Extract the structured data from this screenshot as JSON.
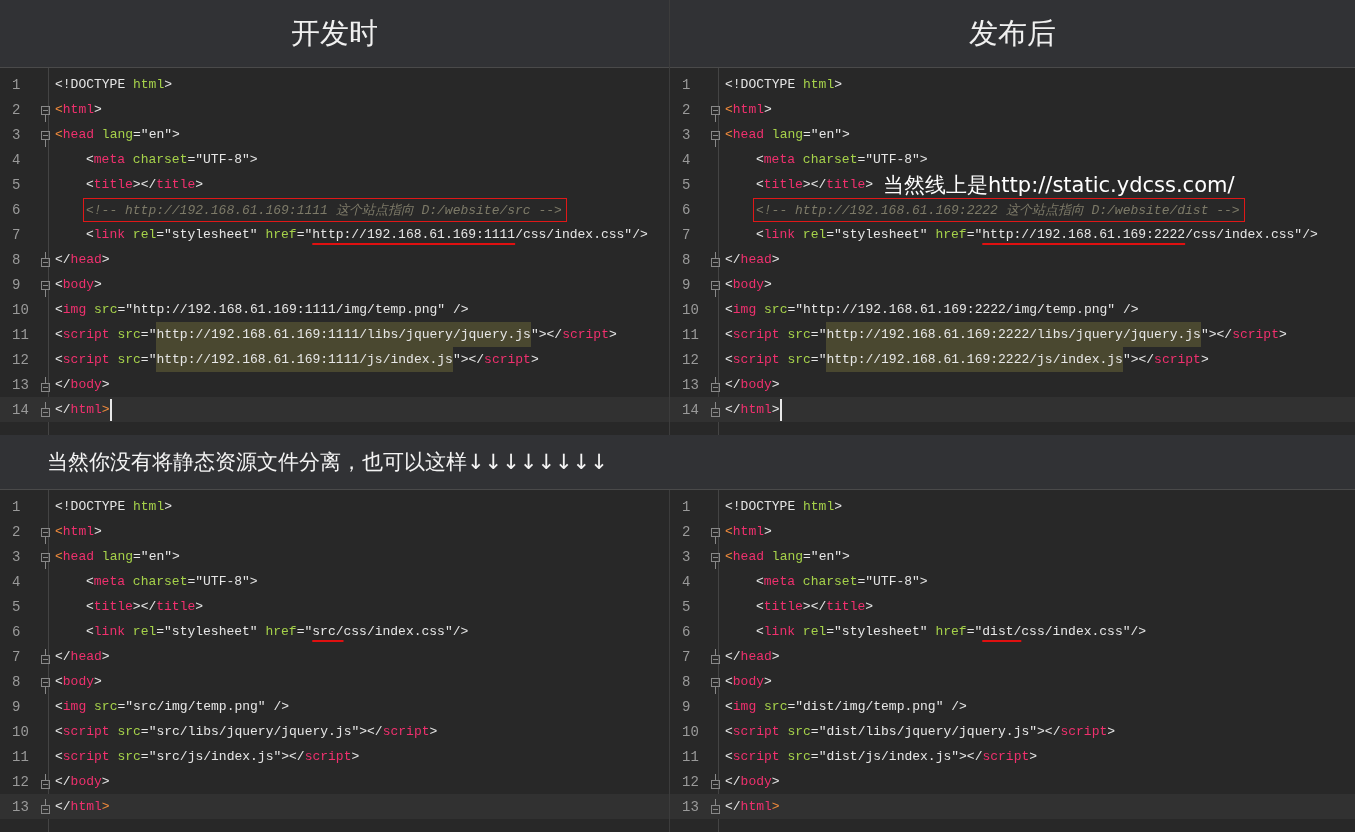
{
  "top_panels": [
    {
      "title": "开发时",
      "lines": [
        {
          "number": "1",
          "current": false,
          "tokens": [
            {
              "kind": "p",
              "text": "<!DOCTYPE "
            },
            {
              "kind": "attr",
              "text": "html"
            },
            {
              "kind": "p",
              "text": ">"
            }
          ]
        },
        {
          "number": "2",
          "current": false,
          "fold_start": true,
          "tokens": [
            {
              "kind": "bracket",
              "text": "<"
            },
            {
              "kind": "tag",
              "text": "html"
            },
            {
              "kind": "p",
              "text": ">"
            }
          ]
        },
        {
          "number": "3",
          "current": false,
          "fold_start": true,
          "tokens": [
            {
              "kind": "bracket",
              "text": "<"
            },
            {
              "kind": "tag",
              "text": "head "
            },
            {
              "kind": "attr",
              "text": "lang"
            },
            {
              "kind": "p",
              "text": "=\"en\">"
            }
          ]
        },
        {
          "number": "4",
          "current": false,
          "indented": true,
          "tokens": [
            {
              "kind": "p",
              "text": "<"
            },
            {
              "kind": "tag",
              "text": "meta "
            },
            {
              "kind": "attr",
              "text": "charset"
            },
            {
              "kind": "p",
              "text": "=\"UTF-8\">"
            }
          ]
        },
        {
          "number": "5",
          "current": false,
          "indented": true,
          "tokens": [
            {
              "kind": "p",
              "text": "<"
            },
            {
              "kind": "tag",
              "text": "title"
            },
            {
              "kind": "p",
              "text": "></"
            },
            {
              "kind": "tag",
              "text": "title"
            },
            {
              "kind": "p",
              "text": ">"
            }
          ]
        },
        {
          "number": "6",
          "current": false,
          "indented": true,
          "tokens": [
            {
              "kind": "boxed_comment",
              "text": "<!-- http://192.168.61.169:1111 这个站点指向 D:/website/src -->"
            }
          ]
        },
        {
          "number": "7",
          "current": false,
          "indented": true,
          "tokens": [
            {
              "kind": "p",
              "text": "<"
            },
            {
              "kind": "tag",
              "text": "link "
            },
            {
              "kind": "attr",
              "text": "rel"
            },
            {
              "kind": "p",
              "text": "=\"stylesheet\" "
            },
            {
              "kind": "attr",
              "text": "href"
            },
            {
              "kind": "p",
              "text": "=\""
            },
            {
              "kind": "underlined",
              "text": "http://192.168.61.169:1111"
            },
            {
              "kind": "p",
              "text": "/css/index.css\"/>"
            }
          ]
        },
        {
          "number": "8",
          "current": false,
          "fold_end": true,
          "tokens": [
            {
              "kind": "p",
              "text": "</"
            },
            {
              "kind": "tag",
              "text": "head"
            },
            {
              "kind": "p",
              "text": ">"
            }
          ]
        },
        {
          "number": "9",
          "current": false,
          "fold_start": true,
          "tokens": [
            {
              "kind": "p",
              "text": "<"
            },
            {
              "kind": "tag",
              "text": "body"
            },
            {
              "kind": "p",
              "text": ">"
            }
          ]
        },
        {
          "number": "10",
          "current": false,
          "tokens": [
            {
              "kind": "p",
              "text": "<"
            },
            {
              "kind": "tag",
              "text": "img "
            },
            {
              "kind": "attr",
              "text": "src"
            },
            {
              "kind": "p",
              "text": "=\"http://192.168.61.169:1111/img/temp.png\" />"
            }
          ]
        },
        {
          "number": "11",
          "current": false,
          "tokens": [
            {
              "kind": "p",
              "text": "<"
            },
            {
              "kind": "tag",
              "text": "script "
            },
            {
              "kind": "attr",
              "text": "src"
            },
            {
              "kind": "p",
              "text": "=\""
            },
            {
              "kind": "match",
              "text": "http://192.168.61.169:1111/libs/jquery/jquery.js"
            },
            {
              "kind": "p",
              "text": "\"></"
            },
            {
              "kind": "tag",
              "text": "script"
            },
            {
              "kind": "p",
              "text": ">"
            }
          ]
        },
        {
          "number": "12",
          "current": false,
          "tokens": [
            {
              "kind": "p",
              "text": "<"
            },
            {
              "kind": "tag",
              "text": "script "
            },
            {
              "kind": "attr",
              "text": "src"
            },
            {
              "kind": "p",
              "text": "=\""
            },
            {
              "kind": "match",
              "text": "http://192.168.61.169:1111/js/index.js"
            },
            {
              "kind": "p",
              "text": "\"></"
            },
            {
              "kind": "tag",
              "text": "script"
            },
            {
              "kind": "p",
              "text": ">"
            }
          ]
        },
        {
          "number": "13",
          "current": false,
          "fold_end": true,
          "tokens": [
            {
              "kind": "p",
              "text": "</"
            },
            {
              "kind": "tag",
              "text": "body"
            },
            {
              "kind": "p",
              "text": ">"
            }
          ]
        },
        {
          "number": "14",
          "current": true,
          "cursor": true,
          "fold_end": true,
          "tokens": [
            {
              "kind": "p",
              "text": "</"
            },
            {
              "kind": "tag",
              "text": "html"
            },
            {
              "kind": "bracket",
              "text": ">"
            }
          ]
        }
      ]
    },
    {
      "title": "发布后",
      "lines": [
        {
          "number": "1",
          "current": false,
          "tokens": [
            {
              "kind": "p",
              "text": "<!DOCTYPE "
            },
            {
              "kind": "attr",
              "text": "html"
            },
            {
              "kind": "p",
              "text": ">"
            }
          ]
        },
        {
          "number": "2",
          "current": false,
          "fold_start": true,
          "tokens": [
            {
              "kind": "bracket",
              "text": "<"
            },
            {
              "kind": "tag",
              "text": "html"
            },
            {
              "kind": "p",
              "text": ">"
            }
          ]
        },
        {
          "number": "3",
          "current": false,
          "fold_start": true,
          "tokens": [
            {
              "kind": "bracket",
              "text": "<"
            },
            {
              "kind": "tag",
              "text": "head "
            },
            {
              "kind": "attr",
              "text": "lang"
            },
            {
              "kind": "p",
              "text": "=\"en\">"
            }
          ]
        },
        {
          "number": "4",
          "current": false,
          "indented": true,
          "tokens": [
            {
              "kind": "p",
              "text": "<"
            },
            {
              "kind": "tag",
              "text": "meta "
            },
            {
              "kind": "attr",
              "text": "charset"
            },
            {
              "kind": "p",
              "text": "=\"UTF-8\">"
            }
          ]
        },
        {
          "number": "5",
          "current": false,
          "indented": true,
          "tokens": [
            {
              "kind": "p",
              "text": "<"
            },
            {
              "kind": "tag",
              "text": "title"
            },
            {
              "kind": "p",
              "text": "></"
            },
            {
              "kind": "tag",
              "text": "title"
            },
            {
              "kind": "p",
              "text": ">"
            },
            {
              "kind": "note",
              "text": "当然线上是http://static.ydcss.com/"
            }
          ]
        },
        {
          "number": "6",
          "current": false,
          "indented": true,
          "tokens": [
            {
              "kind": "boxed_comment",
              "text": "<!-- http://192.168.61.169:2222 这个站点指向 D:/website/dist -->"
            }
          ]
        },
        {
          "number": "7",
          "current": false,
          "indented": true,
          "tokens": [
            {
              "kind": "p",
              "text": "<"
            },
            {
              "kind": "tag",
              "text": "link "
            },
            {
              "kind": "attr",
              "text": "rel"
            },
            {
              "kind": "p",
              "text": "=\"stylesheet\" "
            },
            {
              "kind": "attr",
              "text": "href"
            },
            {
              "kind": "p",
              "text": "=\""
            },
            {
              "kind": "underlined",
              "text": "http://192.168.61.169:2222"
            },
            {
              "kind": "p",
              "text": "/css/index.css\"/>"
            }
          ]
        },
        {
          "number": "8",
          "current": false,
          "fold_end": true,
          "tokens": [
            {
              "kind": "p",
              "text": "</"
            },
            {
              "kind": "tag",
              "text": "head"
            },
            {
              "kind": "p",
              "text": ">"
            }
          ]
        },
        {
          "number": "9",
          "current": false,
          "fold_start": true,
          "tokens": [
            {
              "kind": "p",
              "text": "<"
            },
            {
              "kind": "tag",
              "text": "body"
            },
            {
              "kind": "p",
              "text": ">"
            }
          ]
        },
        {
          "number": "10",
          "current": false,
          "tokens": [
            {
              "kind": "p",
              "text": "<"
            },
            {
              "kind": "tag",
              "text": "img "
            },
            {
              "kind": "attr",
              "text": "src"
            },
            {
              "kind": "p",
              "text": "=\"http://192.168.61.169:2222/img/temp.png\" />"
            }
          ]
        },
        {
          "number": "11",
          "current": false,
          "tokens": [
            {
              "kind": "p",
              "text": "<"
            },
            {
              "kind": "tag",
              "text": "script "
            },
            {
              "kind": "attr",
              "text": "src"
            },
            {
              "kind": "p",
              "text": "=\""
            },
            {
              "kind": "match",
              "text": "http://192.168.61.169:2222/libs/jquery/jquery.js"
            },
            {
              "kind": "p",
              "text": "\"></"
            },
            {
              "kind": "tag",
              "text": "script"
            },
            {
              "kind": "p",
              "text": ">"
            }
          ]
        },
        {
          "number": "12",
          "current": false,
          "tokens": [
            {
              "kind": "p",
              "text": "<"
            },
            {
              "kind": "tag",
              "text": "script "
            },
            {
              "kind": "attr",
              "text": "src"
            },
            {
              "kind": "p",
              "text": "=\""
            },
            {
              "kind": "match",
              "text": "http://192.168.61.169:2222/js/index.js"
            },
            {
              "kind": "p",
              "text": "\"></"
            },
            {
              "kind": "tag",
              "text": "script"
            },
            {
              "kind": "p",
              "text": ">"
            }
          ]
        },
        {
          "number": "13",
          "current": false,
          "fold_end": true,
          "tokens": [
            {
              "kind": "p",
              "text": "</"
            },
            {
              "kind": "tag",
              "text": "body"
            },
            {
              "kind": "p",
              "text": ">"
            }
          ]
        },
        {
          "number": "14",
          "current": true,
          "cursor": true,
          "fold_end": true,
          "tokens": [
            {
              "kind": "p",
              "text": "</"
            },
            {
              "kind": "tag",
              "text": "html"
            },
            {
              "kind": "p",
              "text": ">"
            }
          ]
        }
      ]
    }
  ],
  "caption": "当然你没有将静态资源文件分离，也可以这样↓↓↓↓↓↓↓↓",
  "bottom_panels": [
    {
      "lines": [
        {
          "number": "1",
          "current": false,
          "tokens": [
            {
              "kind": "p",
              "text": "<!DOCTYPE "
            },
            {
              "kind": "attr",
              "text": "html"
            },
            {
              "kind": "p",
              "text": ">"
            }
          ]
        },
        {
          "number": "2",
          "current": false,
          "fold_start": true,
          "tokens": [
            {
              "kind": "bracket",
              "text": "<"
            },
            {
              "kind": "tag",
              "text": "html"
            },
            {
              "kind": "p",
              "text": ">"
            }
          ]
        },
        {
          "number": "3",
          "current": false,
          "fold_start": true,
          "tokens": [
            {
              "kind": "bracket",
              "text": "<"
            },
            {
              "kind": "tag",
              "text": "head "
            },
            {
              "kind": "attr",
              "text": "lang"
            },
            {
              "kind": "p",
              "text": "=\"en\">"
            }
          ]
        },
        {
          "number": "4",
          "current": false,
          "indented": true,
          "tokens": [
            {
              "kind": "p",
              "text": "<"
            },
            {
              "kind": "tag",
              "text": "meta "
            },
            {
              "kind": "attr",
              "text": "charset"
            },
            {
              "kind": "p",
              "text": "=\"UTF-8\">"
            }
          ]
        },
        {
          "number": "5",
          "current": false,
          "indented": true,
          "tokens": [
            {
              "kind": "p",
              "text": "<"
            },
            {
              "kind": "tag",
              "text": "title"
            },
            {
              "kind": "p",
              "text": "></"
            },
            {
              "kind": "tag",
              "text": "title"
            },
            {
              "kind": "p",
              "text": ">"
            }
          ]
        },
        {
          "number": "6",
          "current": false,
          "indented": true,
          "tokens": [
            {
              "kind": "p",
              "text": "<"
            },
            {
              "kind": "tag",
              "text": "link "
            },
            {
              "kind": "attr",
              "text": "rel"
            },
            {
              "kind": "p",
              "text": "=\"stylesheet\" "
            },
            {
              "kind": "attr",
              "text": "href"
            },
            {
              "kind": "p",
              "text": "=\""
            },
            {
              "kind": "underlined",
              "text": "src/"
            },
            {
              "kind": "p",
              "text": "css/index.css\"/>"
            }
          ]
        },
        {
          "number": "7",
          "current": false,
          "fold_end": true,
          "tokens": [
            {
              "kind": "p",
              "text": "</"
            },
            {
              "kind": "tag",
              "text": "head"
            },
            {
              "kind": "p",
              "text": ">"
            }
          ]
        },
        {
          "number": "8",
          "current": false,
          "fold_start": true,
          "tokens": [
            {
              "kind": "p",
              "text": "<"
            },
            {
              "kind": "tag",
              "text": "body"
            },
            {
              "kind": "p",
              "text": ">"
            }
          ]
        },
        {
          "number": "9",
          "current": false,
          "tokens": [
            {
              "kind": "p",
              "text": "<"
            },
            {
              "kind": "tag",
              "text": "img "
            },
            {
              "kind": "attr",
              "text": "src"
            },
            {
              "kind": "p",
              "text": "=\"src/img/temp.png\" />"
            }
          ]
        },
        {
          "number": "10",
          "current": false,
          "tokens": [
            {
              "kind": "p",
              "text": "<"
            },
            {
              "kind": "tag",
              "text": "script "
            },
            {
              "kind": "attr",
              "text": "src"
            },
            {
              "kind": "p",
              "text": "=\"src/libs/jquery/jquery.js\"></"
            },
            {
              "kind": "tag",
              "text": "script"
            },
            {
              "kind": "p",
              "text": ">"
            }
          ]
        },
        {
          "number": "11",
          "current": false,
          "tokens": [
            {
              "kind": "p",
              "text": "<"
            },
            {
              "kind": "tag",
              "text": "script "
            },
            {
              "kind": "attr",
              "text": "src"
            },
            {
              "kind": "p",
              "text": "=\"src/js/index.js\"></"
            },
            {
              "kind": "tag",
              "text": "script"
            },
            {
              "kind": "p",
              "text": ">"
            }
          ]
        },
        {
          "number": "12",
          "current": false,
          "fold_end": true,
          "tokens": [
            {
              "kind": "p",
              "text": "</"
            },
            {
              "kind": "tag",
              "text": "body"
            },
            {
              "kind": "p",
              "text": ">"
            }
          ]
        },
        {
          "number": "13",
          "current": true,
          "fold_end": true,
          "tokens": [
            {
              "kind": "p",
              "text": "</"
            },
            {
              "kind": "tag",
              "text": "html"
            },
            {
              "kind": "bracket",
              "text": ">"
            }
          ]
        }
      ]
    },
    {
      "lines": [
        {
          "number": "1",
          "current": false,
          "tokens": [
            {
              "kind": "p",
              "text": "<!DOCTYPE "
            },
            {
              "kind": "attr",
              "text": "html"
            },
            {
              "kind": "p",
              "text": ">"
            }
          ]
        },
        {
          "number": "2",
          "current": false,
          "fold_start": true,
          "tokens": [
            {
              "kind": "bracket",
              "text": "<"
            },
            {
              "kind": "tag",
              "text": "html"
            },
            {
              "kind": "p",
              "text": ">"
            }
          ]
        },
        {
          "number": "3",
          "current": false,
          "fold_start": true,
          "tokens": [
            {
              "kind": "bracket",
              "text": "<"
            },
            {
              "kind": "tag",
              "text": "head "
            },
            {
              "kind": "attr",
              "text": "lang"
            },
            {
              "kind": "p",
              "text": "=\"en\">"
            }
          ]
        },
        {
          "number": "4",
          "current": false,
          "indented": true,
          "tokens": [
            {
              "kind": "p",
              "text": "<"
            },
            {
              "kind": "tag",
              "text": "meta "
            },
            {
              "kind": "attr",
              "text": "charset"
            },
            {
              "kind": "p",
              "text": "=\"UTF-8\">"
            }
          ]
        },
        {
          "number": "5",
          "current": false,
          "indented": true,
          "tokens": [
            {
              "kind": "p",
              "text": "<"
            },
            {
              "kind": "tag",
              "text": "title"
            },
            {
              "kind": "p",
              "text": "></"
            },
            {
              "kind": "tag",
              "text": "title"
            },
            {
              "kind": "p",
              "text": ">"
            }
          ]
        },
        {
          "number": "6",
          "current": false,
          "indented": true,
          "tokens": [
            {
              "kind": "p",
              "text": "<"
            },
            {
              "kind": "tag",
              "text": "link "
            },
            {
              "kind": "attr",
              "text": "rel"
            },
            {
              "kind": "p",
              "text": "=\"stylesheet\" "
            },
            {
              "kind": "attr",
              "text": "href"
            },
            {
              "kind": "p",
              "text": "=\""
            },
            {
              "kind": "underlined",
              "text": "dist/"
            },
            {
              "kind": "p",
              "text": "css/index.css\"/>"
            }
          ]
        },
        {
          "number": "7",
          "current": false,
          "fold_end": true,
          "tokens": [
            {
              "kind": "p",
              "text": "</"
            },
            {
              "kind": "tag",
              "text": "head"
            },
            {
              "kind": "p",
              "text": ">"
            }
          ]
        },
        {
          "number": "8",
          "current": false,
          "fold_start": true,
          "tokens": [
            {
              "kind": "p",
              "text": "<"
            },
            {
              "kind": "tag",
              "text": "body"
            },
            {
              "kind": "p",
              "text": ">"
            }
          ]
        },
        {
          "number": "9",
          "current": false,
          "tokens": [
            {
              "kind": "p",
              "text": "<"
            },
            {
              "kind": "tag",
              "text": "img "
            },
            {
              "kind": "attr",
              "text": "src"
            },
            {
              "kind": "p",
              "text": "=\"dist/img/temp.png\" />"
            }
          ]
        },
        {
          "number": "10",
          "current": false,
          "tokens": [
            {
              "kind": "p",
              "text": "<"
            },
            {
              "kind": "tag",
              "text": "script "
            },
            {
              "kind": "attr",
              "text": "src"
            },
            {
              "kind": "p",
              "text": "=\"dist/libs/jquery/jquery.js\"></"
            },
            {
              "kind": "tag",
              "text": "script"
            },
            {
              "kind": "p",
              "text": ">"
            }
          ]
        },
        {
          "number": "11",
          "current": false,
          "tokens": [
            {
              "kind": "p",
              "text": "<"
            },
            {
              "kind": "tag",
              "text": "script "
            },
            {
              "kind": "attr",
              "text": "src"
            },
            {
              "kind": "p",
              "text": "=\"dist/js/index.js\"></"
            },
            {
              "kind": "tag",
              "text": "script"
            },
            {
              "kind": "p",
              "text": ">"
            }
          ]
        },
        {
          "number": "12",
          "current": false,
          "fold_end": true,
          "tokens": [
            {
              "kind": "p",
              "text": "</"
            },
            {
              "kind": "tag",
              "text": "body"
            },
            {
              "kind": "p",
              "text": ">"
            }
          ]
        },
        {
          "number": "13",
          "current": true,
          "fold_end": true,
          "tokens": [
            {
              "kind": "p",
              "text": "</"
            },
            {
              "kind": "tag",
              "text": "html"
            },
            {
              "kind": "bracket",
              "text": ">"
            }
          ]
        }
      ]
    }
  ]
}
